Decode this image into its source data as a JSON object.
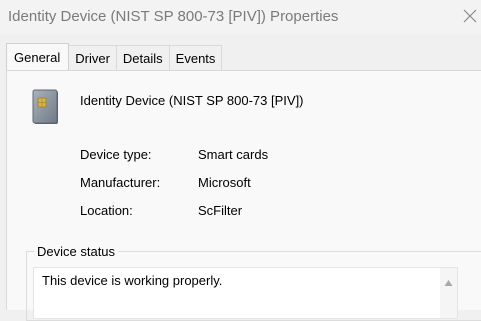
{
  "window": {
    "title": "Identity Device (NIST SP 800-73 [PIV]) Properties",
    "close_icon": "close-icon"
  },
  "tabs": [
    {
      "label": "General",
      "active": true
    },
    {
      "label": "Driver",
      "active": false
    },
    {
      "label": "Details",
      "active": false
    },
    {
      "label": "Events",
      "active": false
    }
  ],
  "general": {
    "device_icon": "smart-card-icon",
    "device_name": "Identity Device (NIST SP 800-73 [PIV])",
    "properties": [
      {
        "label": "Device type:",
        "value": "Smart cards"
      },
      {
        "label": "Manufacturer:",
        "value": "Microsoft"
      },
      {
        "label": "Location:",
        "value": "ScFilter"
      }
    ],
    "status": {
      "legend": "Device status",
      "text": "This device is working properly."
    }
  },
  "colors": {
    "window_bg": "#f0f0f0",
    "panel_bg": "#f9f9f9",
    "title_text": "#7a7a7a"
  }
}
